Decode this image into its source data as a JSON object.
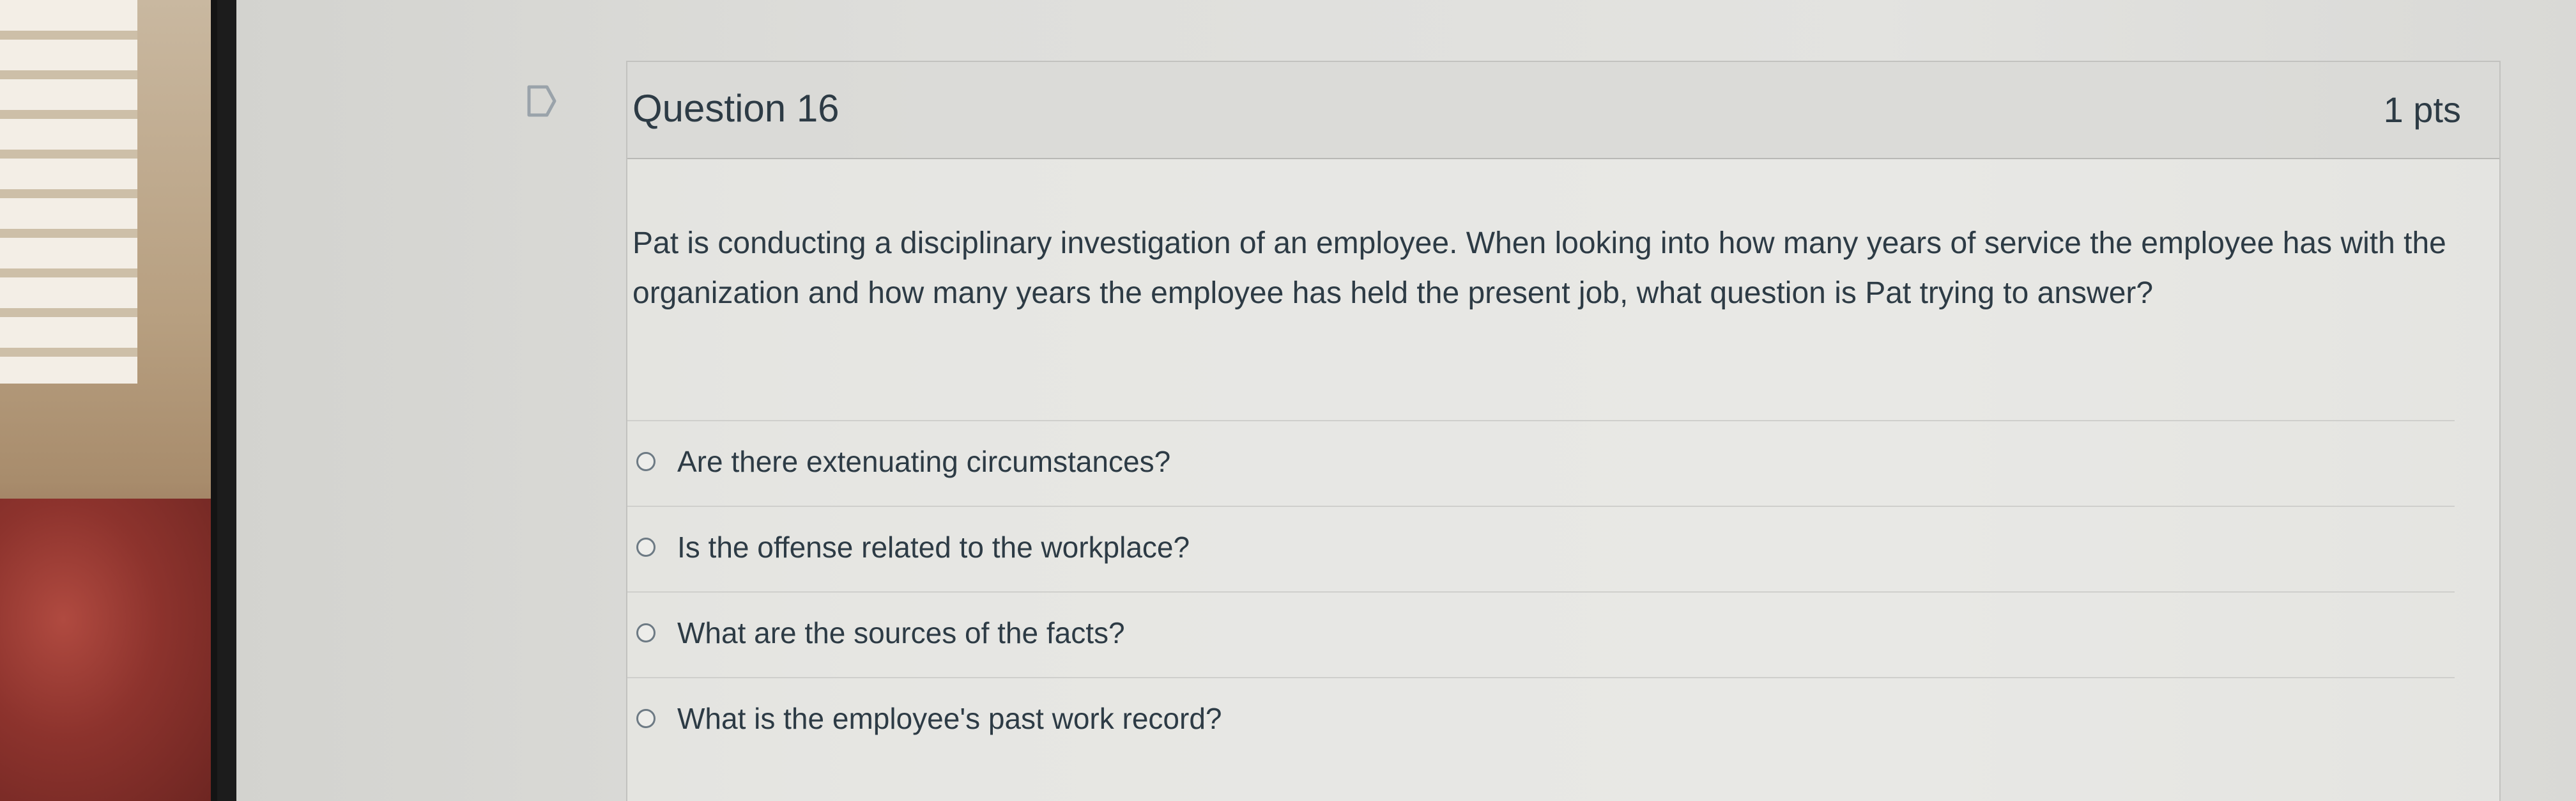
{
  "question": {
    "title": "Question 16",
    "points": "1 pts",
    "text": "Pat is conducting a disciplinary investigation of an employee. When looking into how many years of service the employee has with the organization and how many years the employee has held the present job, what question is Pat trying to answer?",
    "answers": [
      {
        "label": "Are there extenuating circumstances?"
      },
      {
        "label": "Is the offense related to the workplace?"
      },
      {
        "label": "What are the sources of the facts?"
      },
      {
        "label": "What is the employee's past work record?"
      }
    ]
  },
  "icons": {
    "flag": "flag-icon",
    "radio": "radio-button-icon"
  },
  "colors": {
    "text": "#2d3b45",
    "border": "#c2c2bf"
  }
}
